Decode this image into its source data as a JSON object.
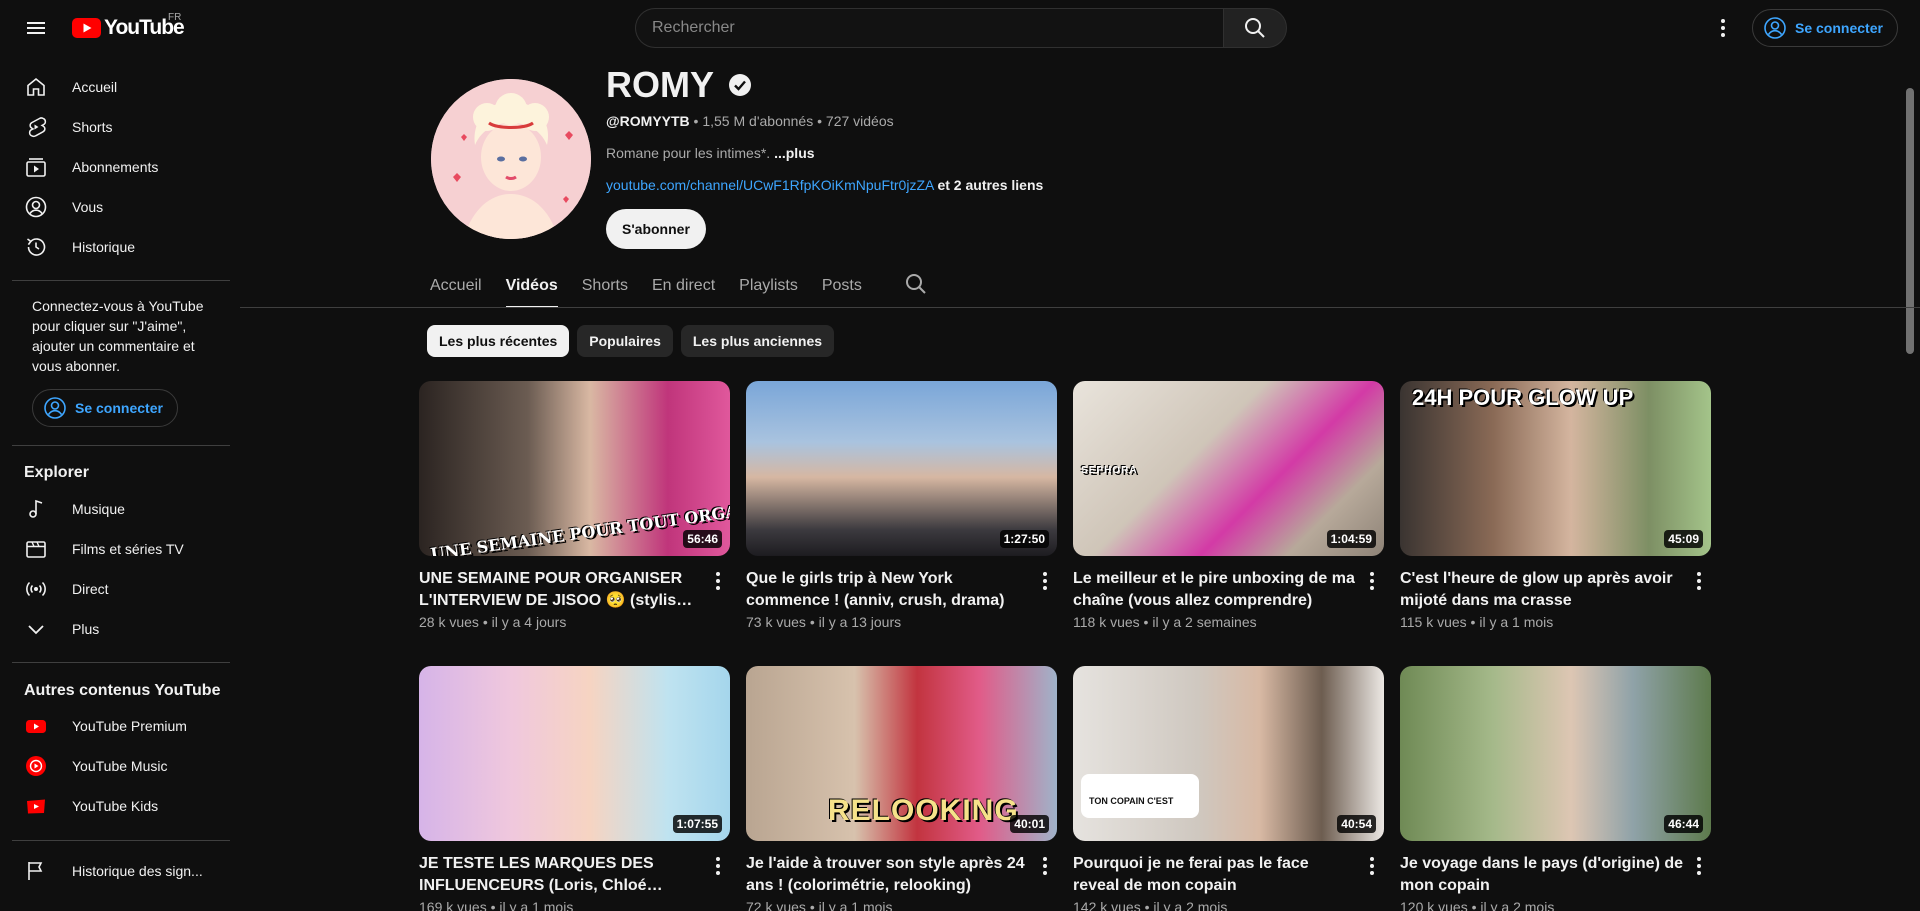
{
  "masthead": {
    "logo_text": "YouTube",
    "country_code": "FR",
    "search_placeholder": "Rechercher",
    "signin_label": "Se connecter"
  },
  "sidebar": {
    "main_items": [
      {
        "label": "Accueil",
        "icon": "home-icon"
      },
      {
        "label": "Shorts",
        "icon": "shorts-icon"
      },
      {
        "label": "Abonnements",
        "icon": "subscriptions-icon"
      },
      {
        "label": "Vous",
        "icon": "you-icon"
      },
      {
        "label": "Historique",
        "icon": "history-icon"
      }
    ],
    "signin_prompt": "Connectez-vous à YouTube pour cliquer sur \"J'aime\", ajouter un commentaire et vous abonner.",
    "signin_label": "Se connecter",
    "explore_heading": "Explorer",
    "explore_items": [
      {
        "label": "Musique",
        "icon": "music-icon"
      },
      {
        "label": "Films et séries TV",
        "icon": "movies-icon"
      },
      {
        "label": "Direct",
        "icon": "live-icon"
      },
      {
        "label": "Plus",
        "icon": "chevron-down-icon"
      }
    ],
    "more_heading": "Autres contenus YouTube",
    "more_items": [
      {
        "label": "YouTube Premium",
        "icon": "youtube-premium-icon"
      },
      {
        "label": "YouTube Music",
        "icon": "youtube-music-icon"
      },
      {
        "label": "YouTube Kids",
        "icon": "youtube-kids-icon"
      }
    ],
    "report_label": "Historique des sign..."
  },
  "channel": {
    "name": "ROMY",
    "handle": "@ROMYYTB",
    "subscribers": "1,55 M d'abonnés",
    "video_count": "727 vidéos",
    "description": "Romane pour les intimes*.",
    "description_more": "...plus",
    "link_url": "youtube.com/channel/UCwF1RfpKOiKmNpuFtr0jzZA",
    "link_more": "et 2 autres liens",
    "subscribe_label": "S'abonner"
  },
  "tabs": [
    {
      "label": "Accueil",
      "active": false
    },
    {
      "label": "Vidéos",
      "active": true
    },
    {
      "label": "Shorts",
      "active": false
    },
    {
      "label": "En direct",
      "active": false
    },
    {
      "label": "Playlists",
      "active": false
    },
    {
      "label": "Posts",
      "active": false
    }
  ],
  "chips": [
    {
      "label": "Les plus récentes",
      "active": true
    },
    {
      "label": "Populaires",
      "active": false
    },
    {
      "label": "Les plus anciennes",
      "active": false
    }
  ],
  "videos": [
    {
      "title": "UNE SEMAINE POUR ORGANISER L'INTERVIEW DE JISOO 🥺 (stylisme, ...",
      "views": "28 k vues",
      "age": "il y a 4 jours",
      "duration": "56:46",
      "overlay": "UNE SEMAINE POUR TOUT ORGANISER"
    },
    {
      "title": "Que le girls trip à New York commence ! (anniv, crush, drama)",
      "views": "73 k vues",
      "age": "il y a 13 jours",
      "duration": "1:27:50",
      "overlay": ""
    },
    {
      "title": "Le meilleur et le pire unboxing de ma chaîne (vous allez comprendre)",
      "views": "118 k vues",
      "age": "il y a 2 semaines",
      "duration": "1:04:59",
      "overlay": "SEPHORA"
    },
    {
      "title": "C'est l'heure de glow up après avoir mijoté dans ma crasse",
      "views": "115 k vues",
      "age": "il y a 1 mois",
      "duration": "45:09",
      "overlay": "24H POUR GLOW UP"
    },
    {
      "title": "JE TESTE LES MARQUES DES INFLUENCEURS (Loris, Chloé Gervais...)",
      "views": "169 k vues",
      "age": "il y a 1 mois",
      "duration": "1:07:55",
      "overlay": ""
    },
    {
      "title": "Je l'aide à trouver son style après 24 ans ! (colorimétrie, relooking)",
      "views": "72 k vues",
      "age": "il y a 1 mois",
      "duration": "40:01",
      "overlay": "RELOOKING"
    },
    {
      "title": "Pourquoi je ne ferai pas le face reveal de mon copain",
      "views": "142 k vues",
      "age": "il y a 2 mois",
      "duration": "40:54",
      "overlay": "TON COPAIN C'EST"
    },
    {
      "title": "Je voyage dans le pays (d'origine) de mon copain",
      "views": "120 k vues",
      "age": "il y a 2 mois",
      "duration": "46:44",
      "overlay": ""
    }
  ],
  "colors": {
    "background": "#0f0f0f",
    "accent_link": "#3ea6ff",
    "youtube_red": "#ff0000",
    "chip_bg": "#272727"
  }
}
